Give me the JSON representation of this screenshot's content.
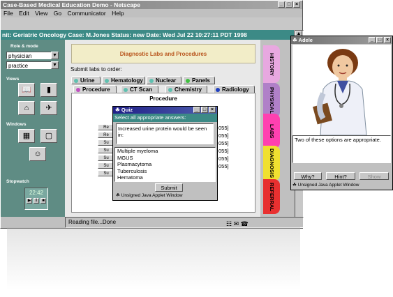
{
  "main_window": {
    "title": "Case-Based Medical Education Demo - Netscape",
    "menu": [
      "File",
      "Edit",
      "View",
      "Go",
      "Communicator",
      "Help"
    ],
    "info_bar": "nit: Geriatric Oncology  Case: M.Jones  Status: new  Date: Wed Jul 22 10:27:11 PDT 1998"
  },
  "left_panel": {
    "role_label": "Role & mode",
    "role_value": "physician",
    "mode_value": "practice",
    "views_label": "Views",
    "windows_label": "Windows",
    "stopwatch_label": "Stopwatch",
    "stopwatch_time": "22:42"
  },
  "content": {
    "header": "Diagnostic Labs and Procedures",
    "submit_prompt": "Submit labs to order:",
    "tabs_row1": [
      "Urine",
      "Hematology",
      "Nuclear",
      "Panels"
    ],
    "tabs_row2": [
      "Procedure",
      "CT Scan",
      "Chemistry",
      "Radiology"
    ],
    "panel_title": "Procedure",
    "row_buttons": [
      "Re",
      "Re",
      "Su",
      "Su",
      "Su",
      "Su",
      "Su"
    ],
    "row_values": [
      "055]",
      "055]",
      "055]",
      "055]",
      "055]",
      "055]"
    ]
  },
  "side_tabs": [
    "HISTORY",
    "PHYSICAL",
    "LABS",
    "DIAGNOSIS",
    "REFERRAL"
  ],
  "status_bar": "Reading file...Done",
  "quiz": {
    "title": "Quiz",
    "instruction": "Select all appropriate answers:",
    "question": "Increased urine protein would be seen in:",
    "options": [
      "Multiple myeloma",
      "MGUS",
      "Plasmacytoma",
      "Tuberculosis",
      "Hematoma"
    ],
    "submit": "Submit",
    "warning": "Unsigned Java Applet Window"
  },
  "adele": {
    "title": "Adele",
    "message": "Two of these options are appropriate.",
    "buttons": [
      "Why?",
      "Hint?",
      "Show"
    ],
    "warning": "Unsigned Java Applet Window"
  },
  "colors": {
    "teal": "#3c8a86",
    "side_tab_colors": [
      "#e8a8e0",
      "#b080c8",
      "#ff40b0",
      "#f0e030",
      "#e83030"
    ]
  }
}
